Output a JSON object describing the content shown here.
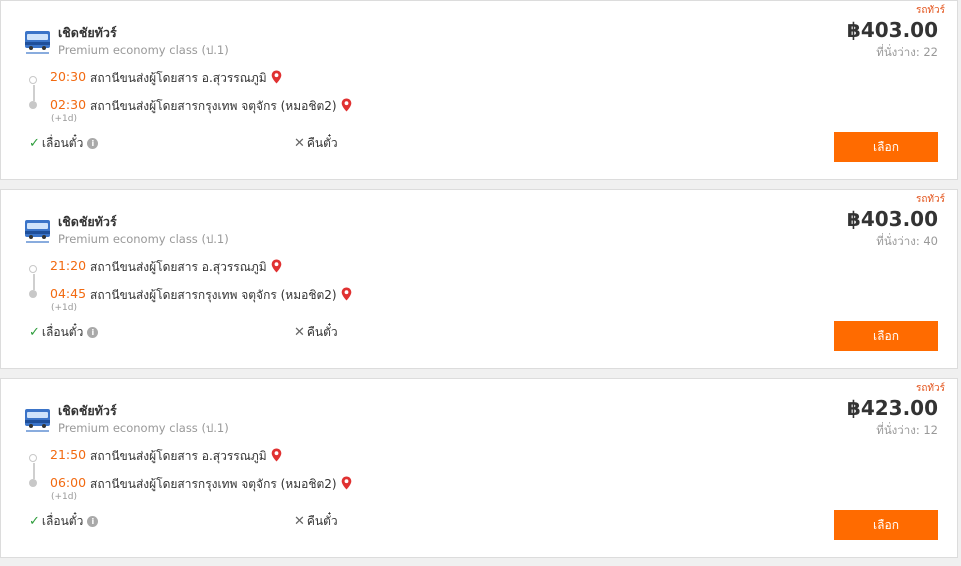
{
  "colors": {
    "accent": "#ff6b00",
    "time": "#f26a11",
    "check": "#2e9d3c",
    "pin": "#e03131"
  },
  "trips": [
    {
      "type_label": "รถทัวร์",
      "operator": "เชิดชัยทัวร์",
      "bus_class": "Premium economy class (ป.1)",
      "depart_time": "20:30",
      "depart_station": "สถานีขนส่งผู้โดยสาร อ.สุวรรณภูมิ",
      "arrive_time": "02:30",
      "arrive_station": "สถานีขนส่งผู้โดยสารกรุงเทพ จตุจักร (หมอชิต2)",
      "next_day": "(+1d)",
      "price": "฿403.00",
      "seats": "ที่นั่งว่าง: 22",
      "reschedule": "เลื่อนตั๋ว",
      "refund": "คืนตั๋ว",
      "select": "เลือก"
    },
    {
      "type_label": "รถทัวร์",
      "operator": "เชิดชัยทัวร์",
      "bus_class": "Premium economy class (ป.1)",
      "depart_time": "21:20",
      "depart_station": "สถานีขนส่งผู้โดยสาร อ.สุวรรณภูมิ",
      "arrive_time": "04:45",
      "arrive_station": "สถานีขนส่งผู้โดยสารกรุงเทพ จตุจักร (หมอชิต2)",
      "next_day": "(+1d)",
      "price": "฿403.00",
      "seats": "ที่นั่งว่าง: 40",
      "reschedule": "เลื่อนตั๋ว",
      "refund": "คืนตั๋ว",
      "select": "เลือก"
    },
    {
      "type_label": "รถทัวร์",
      "operator": "เชิดชัยทัวร์",
      "bus_class": "Premium economy class (ป.1)",
      "depart_time": "21:50",
      "depart_station": "สถานีขนส่งผู้โดยสาร อ.สุวรรณภูมิ",
      "arrive_time": "06:00",
      "arrive_station": "สถานีขนส่งผู้โดยสารกรุงเทพ จตุจักร (หมอชิต2)",
      "next_day": "(+1d)",
      "price": "฿423.00",
      "seats": "ที่นั่งว่าง: 12",
      "reschedule": "เลื่อนตั๋ว",
      "refund": "คืนตั๋ว",
      "select": "เลือก"
    }
  ]
}
